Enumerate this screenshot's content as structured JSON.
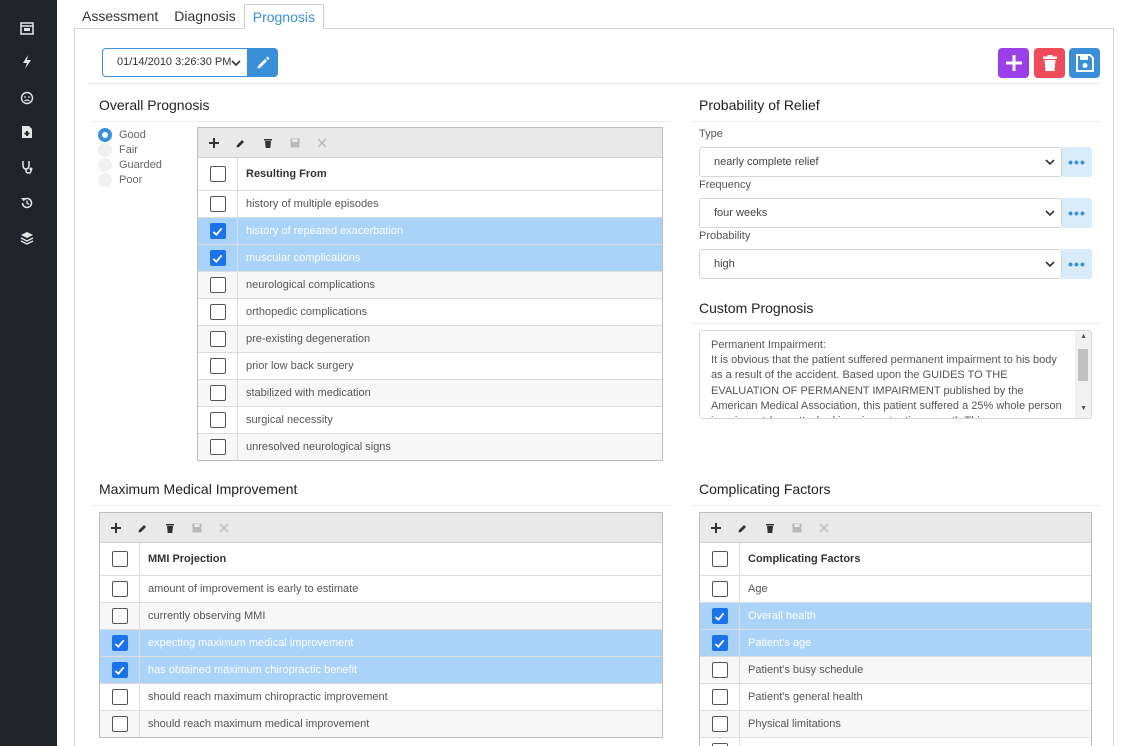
{
  "tabs": [
    {
      "label": "Assessment"
    },
    {
      "label": "Diagnosis"
    },
    {
      "label": "Prognosis"
    }
  ],
  "active_tab": "Prognosis",
  "toolbar": {
    "date_value": "01/14/2010 3:26:30 PM"
  },
  "sidebar": {
    "icons": [
      "calendar-icon",
      "lightning-icon",
      "face-icon",
      "document-icon",
      "stethoscope-icon",
      "history-icon",
      "layers-icon"
    ]
  },
  "overall_prognosis": {
    "title": "Overall Prognosis",
    "options": [
      {
        "label": "Good",
        "selected": true
      },
      {
        "label": "Fair",
        "selected": false
      },
      {
        "label": "Guarded",
        "selected": false
      },
      {
        "label": "Poor",
        "selected": false
      }
    ],
    "grid": {
      "header": "Resulting From",
      "rows": [
        {
          "label": "history of multiple episodes",
          "checked": false
        },
        {
          "label": "history of repeated exacerbation",
          "checked": true
        },
        {
          "label": "muscular complications",
          "checked": true
        },
        {
          "label": "neurological complications",
          "checked": false
        },
        {
          "label": "orthopedic complications",
          "checked": false
        },
        {
          "label": "pre-existing degeneration",
          "checked": false
        },
        {
          "label": "prior low back surgery",
          "checked": false
        },
        {
          "label": "stabilized with medication",
          "checked": false
        },
        {
          "label": "surgical necessity",
          "checked": false
        },
        {
          "label": "unresolved neurological signs",
          "checked": false
        }
      ]
    }
  },
  "probability_of_relief": {
    "title": "Probability of Relief",
    "type_label": "Type",
    "type_value": "nearly complete relief",
    "frequency_label": "Frequency",
    "frequency_value": "four weeks",
    "probability_label": "Probability",
    "probability_value": "high"
  },
  "custom_prognosis": {
    "title": "Custom Prognosis",
    "text": "Permanent Impairment:\nIt is obvious that the patient suffered permanent impairment to his body as a result of the accident. Based upon the GUIDES TO THE EVALUATION OF PERMANENT IMPAIRMENT published by the American Medical Association, this patient suffered a 25% whole person impairment (see attached impairment rating report). This means"
  },
  "mmi": {
    "title": "Maximum Medical Improvement",
    "grid": {
      "header": "MMI Projection",
      "rows": [
        {
          "label": "amount of improvement is early to estimate",
          "checked": false
        },
        {
          "label": "currently observing MMI",
          "checked": false
        },
        {
          "label": "expecting maximum medical improvement",
          "checked": true
        },
        {
          "label": "has obtained maximum chiropractic benefit",
          "checked": true
        },
        {
          "label": "should reach maximum chiropractic improvement",
          "checked": false
        },
        {
          "label": "should reach maximum medical improvement",
          "checked": false
        }
      ]
    }
  },
  "complicating_factors": {
    "title": "Complicating Factors",
    "grid": {
      "header": "Complicating Factors",
      "rows": [
        {
          "label": "Age",
          "checked": false
        },
        {
          "label": "Overall health",
          "checked": true
        },
        {
          "label": "Patient's age",
          "checked": true
        },
        {
          "label": "Patient's busy schedule",
          "checked": false
        },
        {
          "label": "Patient's general health",
          "checked": false
        },
        {
          "label": "Physical limitations",
          "checked": false
        },
        {
          "label": "",
          "checked": false
        }
      ]
    }
  },
  "colors": {
    "accent": "#3a8fd9",
    "add": "#9b3fe8",
    "delete": "#f04b5b",
    "selected_row": "#a9d3f8",
    "sidebar": "#22242b"
  }
}
